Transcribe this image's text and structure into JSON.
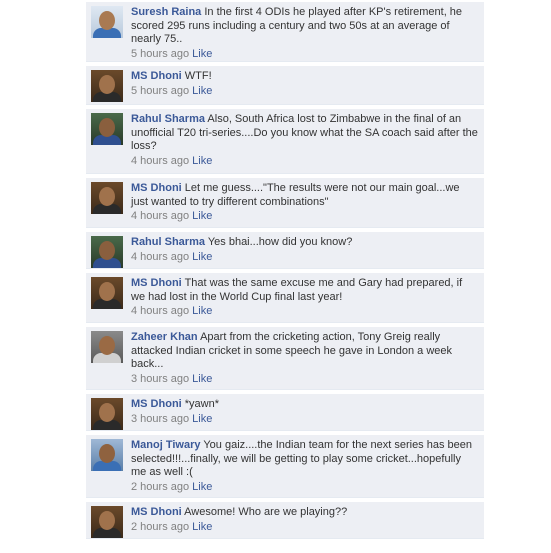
{
  "comments": [
    {
      "name": "Suresh Raina",
      "text": "In the first 4 ODIs he played after KP's retirement, he scored 295 runs including a century and two 50s at an average of nearly 75..",
      "time": "5 hours ago",
      "like": "Like",
      "avatar": "raina"
    },
    {
      "name": "MS Dhoni",
      "text": "WTF!",
      "time": "5 hours ago",
      "like": "Like",
      "avatar": "dhoni"
    },
    {
      "name": "Rahul Sharma",
      "text": "Also, South Africa lost to Zimbabwe in the final of an unofficial T20 tri-series....Do you know what the SA coach said after the loss?",
      "time": "4 hours ago",
      "like": "Like",
      "avatar": "rahul"
    },
    {
      "name": "MS Dhoni",
      "text": "Let me guess....\"The results were not our main goal...we just wanted to try different combinations\"",
      "time": "4 hours ago",
      "like": "Like",
      "avatar": "dhoni"
    },
    {
      "name": "Rahul Sharma",
      "text": "Yes bhai...how did you know?",
      "time": "4 hours ago",
      "like": "Like",
      "avatar": "rahul"
    },
    {
      "name": "MS Dhoni",
      "text": "That was the same excuse me and Gary had prepared, if we had lost in the World Cup final last year!",
      "time": "4 hours ago",
      "like": "Like",
      "avatar": "dhoni"
    },
    {
      "name": "Zaheer Khan",
      "text": "Apart from the cricketing action, Tony Greig really attacked Indian cricket in some speech he gave in London a week back...",
      "time": "3 hours ago",
      "like": "Like",
      "avatar": "zaheer"
    },
    {
      "name": "MS Dhoni",
      "text": "*yawn*",
      "time": "3 hours ago",
      "like": "Like",
      "avatar": "dhoni"
    },
    {
      "name": "Manoj Tiwary",
      "text": "You gaiz....the Indian team for the next series has been selected!!!...finally, we will be getting to play some cricket...hopefully me as well :(",
      "time": "2 hours ago",
      "like": "Like",
      "avatar": "manoj"
    },
    {
      "name": "MS Dhoni",
      "text": "Awesome! Who are we playing??",
      "time": "2 hours ago",
      "like": "Like",
      "avatar": "dhoni"
    }
  ],
  "colors": {
    "name_link": "#3b5998",
    "comment_bg": "#edeff4",
    "timestamp": "#808080"
  }
}
